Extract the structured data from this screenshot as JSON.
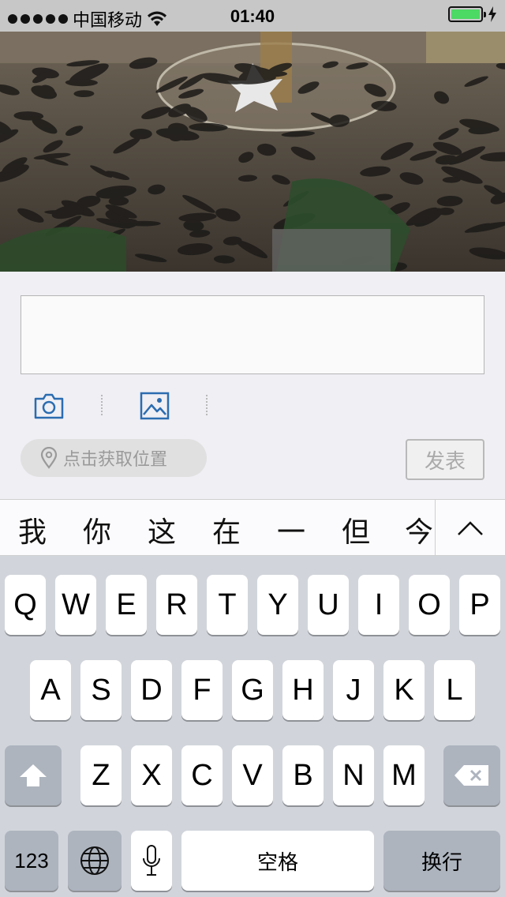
{
  "status_bar": {
    "carrier": "中国移动",
    "time": "01:40",
    "battery_level": 1.0,
    "battery_color": "#4cd964"
  },
  "photo": {
    "icon": "photo-crowd-image"
  },
  "compose": {
    "text_value": "",
    "camera_icon": "camera-icon",
    "gallery_icon": "image-icon",
    "location_label": "点击获取位置",
    "publish_label": "发表"
  },
  "suggestions": {
    "candidates": [
      "我",
      "你",
      "这",
      "在",
      "一",
      "但",
      "今"
    ],
    "expand_icon": "chevron-up-icon"
  },
  "keyboard": {
    "row1": [
      "Q",
      "W",
      "E",
      "R",
      "T",
      "Y",
      "U",
      "I",
      "O",
      "P"
    ],
    "row2": [
      "A",
      "S",
      "D",
      "F",
      "G",
      "H",
      "J",
      "K",
      "L"
    ],
    "row3": [
      "Z",
      "X",
      "C",
      "V",
      "B",
      "N",
      "M"
    ],
    "numbers_label": "123",
    "space_label": "空格",
    "return_label": "换行"
  }
}
